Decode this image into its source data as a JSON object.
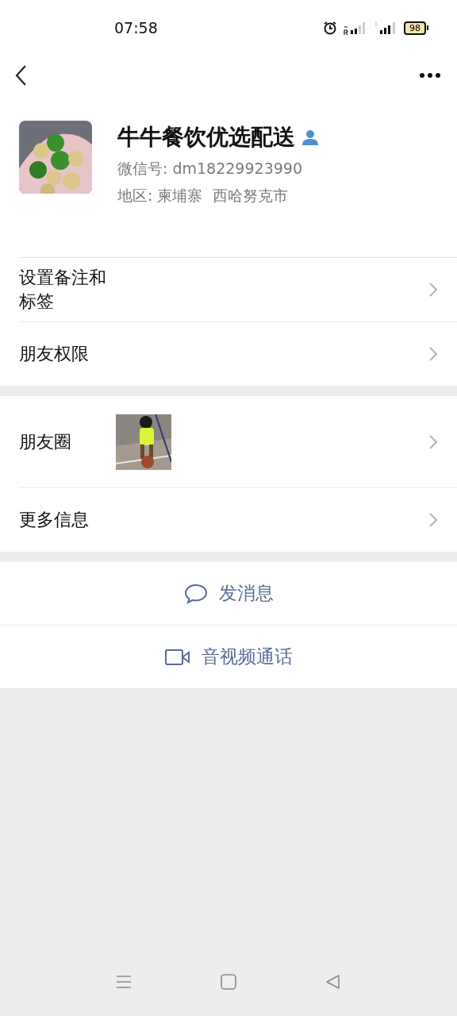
{
  "status_bar": {
    "time": "07:58",
    "battery": "98"
  },
  "profile": {
    "name": "牛牛餐饮优选配送",
    "wechat_id": "微信号: dm18229923990",
    "region": "地区: 柬埔寨  西哈努克市"
  },
  "menu_groups": [
    [
      {
        "label": "设置备注和标签",
        "kind": "plain"
      },
      {
        "label": "朋友权限",
        "kind": "plain"
      }
    ],
    [
      {
        "label": "朋友圈",
        "kind": "moments"
      },
      {
        "label": "更多信息",
        "kind": "plain"
      }
    ]
  ],
  "actions": [
    {
      "label": "发消息",
      "kind": "message"
    },
    {
      "label": "音视频通话",
      "kind": "video"
    }
  ]
}
